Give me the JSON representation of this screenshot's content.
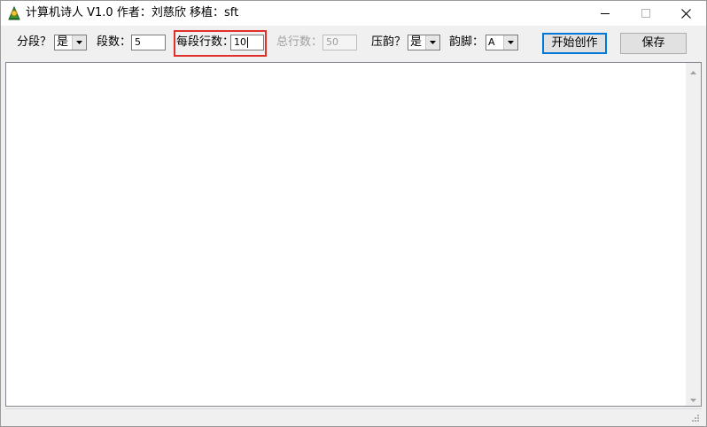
{
  "window": {
    "title": "计算机诗人 V1.0 作者：刘慈欣 移植：sft"
  },
  "toolbar": {
    "segment": {
      "label": "分段？",
      "value": "是"
    },
    "segment_count": {
      "label": "段数：",
      "value": "5"
    },
    "lines_per_segment": {
      "label": "每段行数：",
      "value": "10"
    },
    "total_lines": {
      "label": "总行数：",
      "value": "50",
      "disabled": true
    },
    "rhyme": {
      "label": "压韵？",
      "value": "是"
    },
    "rhyme_foot": {
      "label": "韵脚：",
      "value": "A"
    },
    "start_button": "开始创作",
    "save_button": "保存"
  },
  "editor": {
    "content": ""
  },
  "statusbar": {
    "text": ""
  },
  "colors": {
    "highlight": "#e0302a",
    "default_button_border": "#0078d7",
    "window_bg": "#f0f0f0"
  },
  "icons": {
    "app": "poet-app-icon",
    "minimize": "minimize-icon",
    "maximize": "maximize-icon",
    "close": "close-icon",
    "dropdown": "chevron-down-icon"
  }
}
